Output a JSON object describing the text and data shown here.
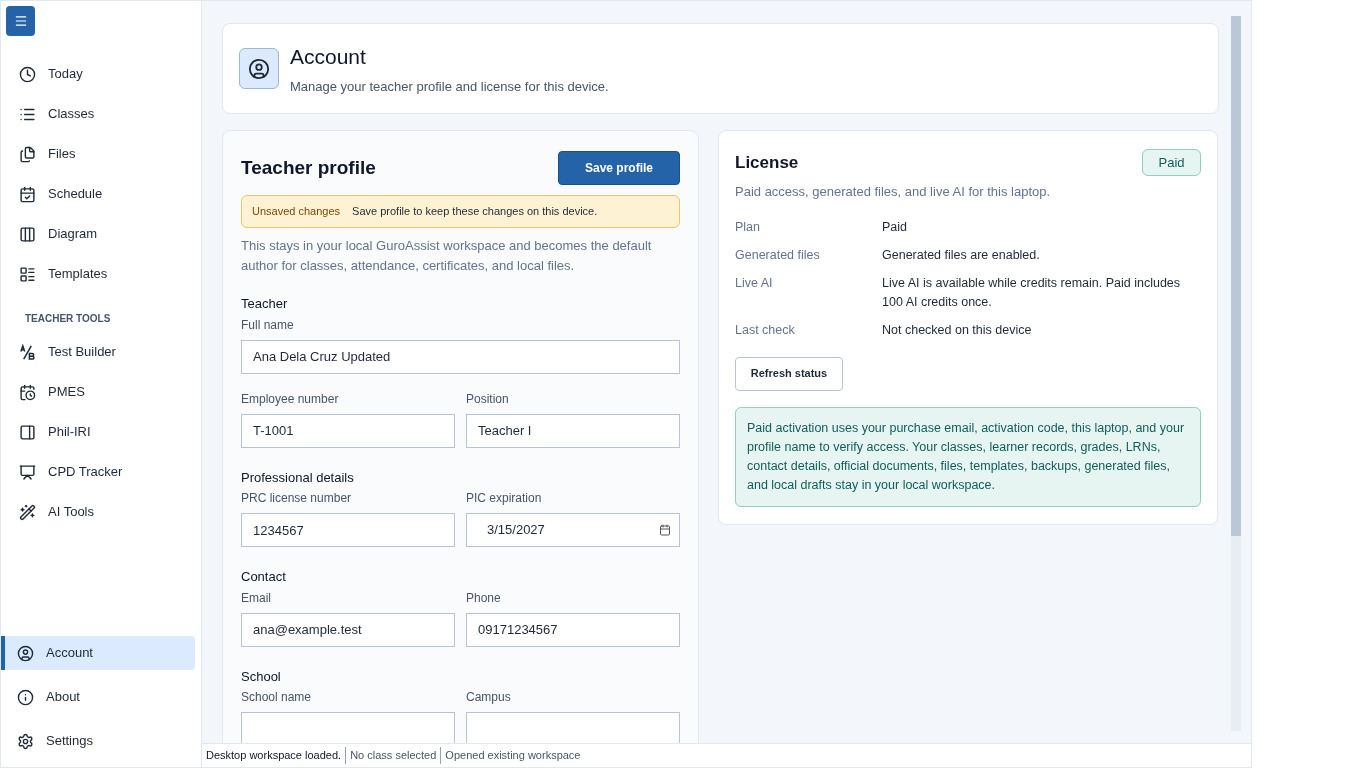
{
  "sidebar": {
    "nav": [
      {
        "label": "Today",
        "selected": false
      },
      {
        "label": "Classes",
        "selected": false
      },
      {
        "label": "Files",
        "selected": false
      },
      {
        "label": "Schedule",
        "selected": false
      },
      {
        "label": "Diagram",
        "selected": false
      },
      {
        "label": "Templates",
        "selected": false
      }
    ],
    "section_label": "TEACHER TOOLS",
    "tools": [
      {
        "label": "Test Builder",
        "selected": false
      },
      {
        "label": "PMES",
        "selected": false
      },
      {
        "label": "Phil-IRI",
        "selected": false
      },
      {
        "label": "CPD Tracker",
        "selected": false
      },
      {
        "label": "AI Tools",
        "selected": false
      }
    ],
    "bottom": [
      {
        "label": "Account",
        "selected": true
      },
      {
        "label": "About",
        "selected": false
      },
      {
        "label": "Settings",
        "selected": false
      }
    ]
  },
  "header": {
    "title": "Account",
    "subtitle": "Manage your teacher profile and license for this device."
  },
  "profile": {
    "title": "Teacher profile",
    "save_button": "Save profile",
    "warning": {
      "label": "Unsaved changes",
      "message": "Save profile to keep these changes on this device."
    },
    "description": "This stays in your local GuroAssist workspace and becomes the default author for classes, attendance, certificates, and local files.",
    "sections": [
      {
        "heading": "Teacher",
        "rows": [
          [
            {
              "label": "Full name",
              "value": "Ana Dela Cruz Updated",
              "kind": "text"
            }
          ],
          [
            {
              "label": "Employee number",
              "value": "T-1001",
              "kind": "text"
            },
            {
              "label": "Position",
              "value": "Teacher I",
              "kind": "text"
            }
          ]
        ]
      },
      {
        "heading": "Professional details",
        "rows": [
          [
            {
              "label": "PRC license number",
              "value": "1234567",
              "kind": "text"
            },
            {
              "label": "PIC expiration",
              "value": "3/15/2027",
              "kind": "date"
            }
          ]
        ]
      },
      {
        "heading": "Contact",
        "rows": [
          [
            {
              "label": "Email",
              "value": "ana@example.test",
              "kind": "text"
            },
            {
              "label": "Phone",
              "value": "09171234567",
              "kind": "text"
            }
          ]
        ]
      },
      {
        "heading": "School",
        "rows": [
          [
            {
              "label": "School name",
              "kind": "text"
            },
            {
              "label": "Campus",
              "kind": "text"
            }
          ]
        ]
      }
    ]
  },
  "license": {
    "title": "License",
    "badge": "Paid",
    "subtitle": "Paid access, generated files, and live AI for this laptop.",
    "details": [
      {
        "label": "Plan",
        "value": "Paid"
      },
      {
        "label": "Generated files",
        "value": "Generated files are enabled."
      },
      {
        "label": "Live AI",
        "value": "Live AI is available while credits remain. Paid includes 100 AI credits once."
      },
      {
        "label": "Last check",
        "value": "Not checked on this device"
      }
    ],
    "refresh_button": "Refresh status",
    "note": "Paid activation uses your purchase email, activation code, this laptop, and your profile name to verify access. Your classes, learner records, grades, LRNs, contact details, official documents, files, templates, backups, generated files, and local drafts stay in your local workspace."
  },
  "status_bar": [
    "Desktop workspace loaded.",
    "No class selected",
    "Opened existing workspace"
  ]
}
